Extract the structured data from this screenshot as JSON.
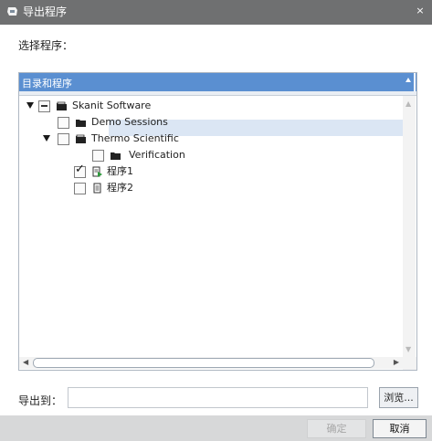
{
  "window": {
    "title": "导出程序",
    "close_glyph": "×"
  },
  "prompt": "选择程序：",
  "panel": {
    "header": "目录和程序"
  },
  "tree": {
    "root": "Skanit Software",
    "demo": "Demo Sessions",
    "thermo": "Thermo Scientific",
    "verification": "Verification",
    "program1": "程序1",
    "program2": "程序2"
  },
  "export": {
    "label": "导出到：",
    "value": "",
    "browse": "浏览..."
  },
  "buttons": {
    "ok": "确定",
    "cancel": "取消"
  },
  "icons": {
    "app": "export-app-icon",
    "folder": "folder-icon",
    "open_folder": "open-folder-icon",
    "program": "program-file-icon",
    "program_alt": "program-file-alt-icon"
  },
  "colors": {
    "titlebar": "#6f7071",
    "panel_header": "#5a8fd1",
    "selection": "#dbe6f4",
    "footer": "#d7d8d9"
  }
}
